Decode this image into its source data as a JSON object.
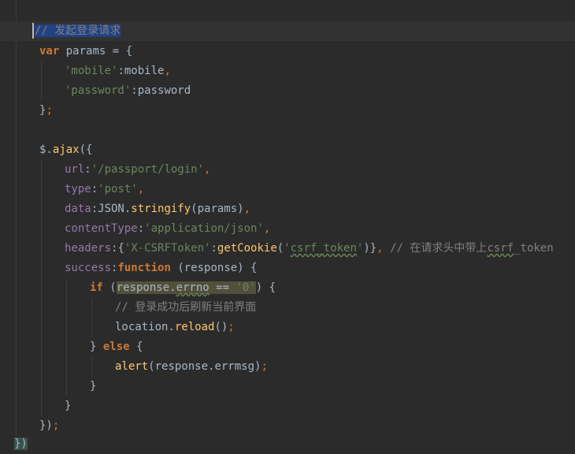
{
  "code": {
    "comment_request": "// 发起登录请求",
    "kw_var": "var",
    "params_decl": " params = {",
    "mobile_key": "'mobile'",
    "mobile_val": ":mobile",
    "comma": ",",
    "password_key": "'password'",
    "password_val": ":password",
    "close_obj": "}",
    "semicolon": ";",
    "dollar": "$.",
    "ajax": "ajax",
    "ajax_open": "({",
    "url_key": "url",
    "url_val": "'/passport/login'",
    "type_key": "type",
    "type_val": "'post'",
    "data_key": "data",
    "json": ":JSON.",
    "stringify": "stringify",
    "stringify_args": "(params)",
    "content_key": "contentType",
    "content_val": "'application/json'",
    "headers_key": "headers",
    "headers_open": ":{",
    "csrf_header": "'X-CSRFToken'",
    "colon": ":",
    "getcookie": "getCookie",
    "paren_open": "(",
    "quote": "'",
    "csrf_token": "csrf_token",
    "headers_close": ")}",
    "comment_header_a": " // 在请求头中带上",
    "comment_header_b": "csrf",
    "comment_header_c": "_token",
    "success_key": "success",
    "kw_function": "function",
    "func_args": " (response) {",
    "kw_if": "if",
    "if_open": " (",
    "response_dot": "response.",
    "errno": "errno",
    "eq": " == ",
    "zero": "'0'",
    "if_close": ") {",
    "comment_success": "// 登录成功后刷新当前界面",
    "location": "location.",
    "reload": "reload",
    "reload_args": "()",
    "else_open": "} ",
    "kw_else": "else",
    "else_brace": " {",
    "alert": "alert",
    "alert_args": "(response.errmsg)",
    "close_brace": "}",
    "close_paren": ")",
    "close_ajax": "})",
    "close_all": "})"
  }
}
